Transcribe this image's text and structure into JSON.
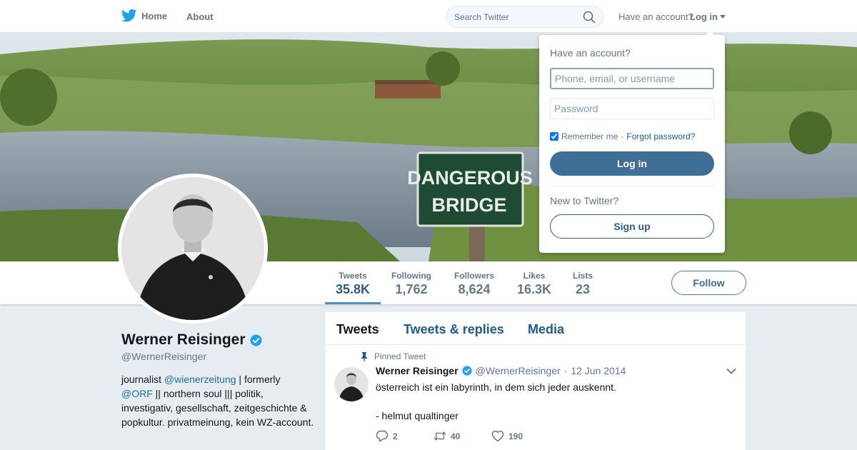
{
  "topbar": {
    "home_label": "Home",
    "about_label": "About",
    "search_placeholder": "Search Twitter",
    "have_account": "Have an account?",
    "login_label": "Log in"
  },
  "banner": {
    "sign_line1": "DANGEROUS",
    "sign_line2": "BRIDGE"
  },
  "profile": {
    "name": "Werner Reisinger",
    "handle": "@WernerReisinger",
    "bio_part1": "journalist ",
    "bio_link1": "@wienerzeitung",
    "bio_part2": " | formerly ",
    "bio_link2": "@ORF",
    "bio_part3": " || northern soul ||| politik, investigativ, gesellschaft, zeitgeschichte & popkultur. privatmeinung, kein WZ-account."
  },
  "stats": [
    {
      "label": "Tweets",
      "value": "35.8K"
    },
    {
      "label": "Following",
      "value": "1,762"
    },
    {
      "label": "Followers",
      "value": "8,624"
    },
    {
      "label": "Likes",
      "value": "16.3K"
    },
    {
      "label": "Lists",
      "value": "23"
    }
  ],
  "follow_label": "Follow",
  "timeline": {
    "tabs": [
      "Tweets",
      "Tweets & replies",
      "Media"
    ],
    "pinned_label": "Pinned Tweet",
    "tweet": {
      "name": "Werner Reisinger",
      "handle": "@WernerReisinger",
      "dot": "·",
      "date": "12 Jun 2014",
      "line1": "österreich ist ein labyrinth, in dem sich jeder auskennt.",
      "line2": "- helmut qualtinger",
      "replies": "2",
      "retweets": "40",
      "likes": "190"
    }
  },
  "login_dropdown": {
    "title": "Have an account?",
    "username_placeholder": "Phone, email, or username",
    "password_placeholder": "Password",
    "remember": "Remember me",
    "separator": "·",
    "forgot": "Forgot password?",
    "login_button": "Log in",
    "new_to": "New to Twitter?",
    "signup_button": "Sign up"
  },
  "colors": {
    "accent": "#3f6e96",
    "link": "#1b5c8f",
    "verified": "#1da1f2"
  }
}
